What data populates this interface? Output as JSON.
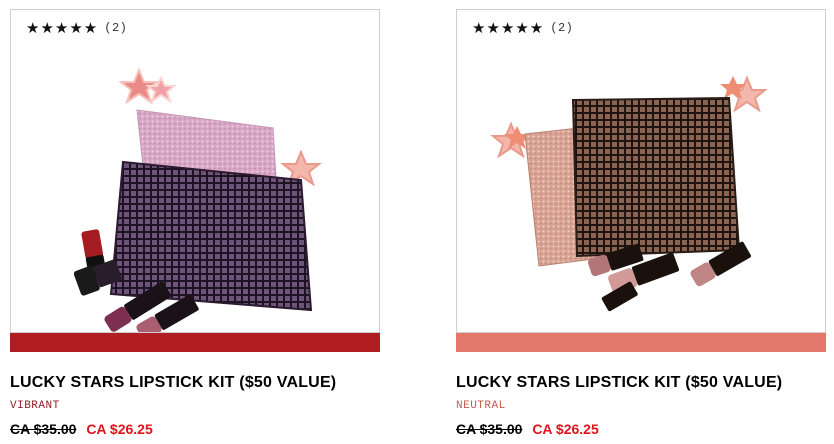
{
  "products": [
    {
      "rating_stars": "★★★★★",
      "review_count": "(2)",
      "image_alt": "Lucky Stars Lipstick Kit - Vibrant",
      "swatch_color": "#b01e23",
      "title": "LUCKY STARS LIPSTICK KIT ($50 VALUE)",
      "shade": "VIBRANT",
      "shade_color": "#8e1b1f",
      "original_price": "CA $35.00",
      "sale_price": "CA $26.25",
      "sale_color": "#e0121a"
    },
    {
      "rating_stars": "★★★★★",
      "review_count": "(2)",
      "image_alt": "Lucky Stars Lipstick Kit - Neutral",
      "swatch_color": "#e2776a",
      "title": "LUCKY STARS LIPSTICK KIT ($50 VALUE)",
      "shade": "NEUTRAL",
      "shade_color": "#c25c4f",
      "original_price": "CA $35.00",
      "sale_price": "CA $26.25",
      "sale_color": "#e0121a"
    }
  ]
}
